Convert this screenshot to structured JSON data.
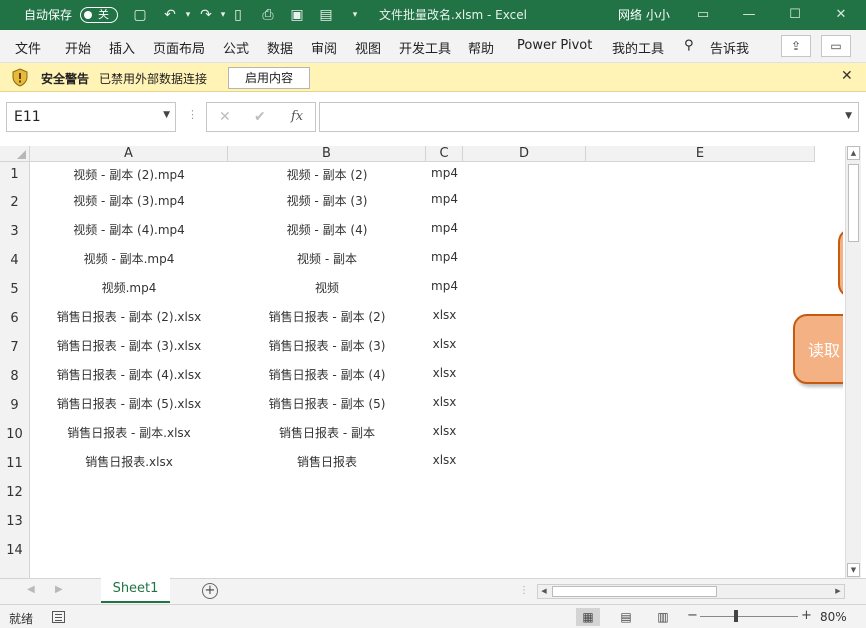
{
  "titlebar": {
    "autosave_label": "自动保存",
    "autosave_state": "关",
    "document_title": "文件批量改名.xlsm  -  Excel",
    "user_name": "网络 小小"
  },
  "menu": {
    "items": [
      "文件",
      "开始",
      "插入",
      "页面布局",
      "公式",
      "数据",
      "审阅",
      "视图",
      "开发工具",
      "帮助",
      "Power Pivot",
      "我的工具"
    ],
    "tell_me": "告诉我"
  },
  "security_bar": {
    "title": "安全警告",
    "message": "已禁用外部数据连接",
    "enable_button": "启用内容"
  },
  "formula_bar": {
    "name_box": "E11",
    "cancel_glyph": "✕",
    "enter_glyph": "✔",
    "fx_glyph": "fx",
    "formula_value": ""
  },
  "sheet": {
    "columns": [
      "A",
      "B",
      "C",
      "D",
      "E"
    ],
    "rows": [
      "1",
      "2",
      "3",
      "4",
      "5",
      "6",
      "7",
      "8",
      "9",
      "10",
      "11",
      "12",
      "13",
      "14"
    ],
    "data": [
      [
        "视频 - 副本 (2).mp4",
        "视频 - 副本 (2)",
        "mp4"
      ],
      [
        "视频 - 副本 (3).mp4",
        "视频 - 副本 (3)",
        "mp4"
      ],
      [
        "视频 - 副本 (4).mp4",
        "视频 - 副本 (4)",
        "mp4"
      ],
      [
        "视频 - 副本.mp4",
        "视频 - 副本",
        "mp4"
      ],
      [
        "视频.mp4",
        "视频",
        "mp4"
      ],
      [
        "销售日报表 - 副本 (2).xlsx",
        "销售日报表 - 副本 (2)",
        "xlsx"
      ],
      [
        "销售日报表 - 副本 (3).xlsx",
        "销售日报表 - 副本 (3)",
        "xlsx"
      ],
      [
        "销售日报表 - 副本 (4).xlsx",
        "销售日报表 - 副本 (4)",
        "xlsx"
      ],
      [
        "销售日报表 - 副本 (5).xlsx",
        "销售日报表 - 副本 (5)",
        "xlsx"
      ],
      [
        "销售日报表 - 副本.xlsx",
        "销售日报表 - 副本",
        "xlsx"
      ],
      [
        "销售日报表.xlsx",
        "销售日报表",
        "xlsx"
      ]
    ],
    "read_button_label": "读取"
  },
  "tabs": {
    "active_sheet": "Sheet1",
    "add_glyph": "+"
  },
  "status": {
    "ready_text": "就绪",
    "zoom_minus": "−",
    "zoom_plus": "+",
    "zoom_level": "80%",
    "zoom_fraction": 0.35
  },
  "colors": {
    "excel_green": "#217346",
    "warning_yellow": "#fff3b5",
    "shape_fill": "#f4b183",
    "shape_border": "#c55a11"
  }
}
